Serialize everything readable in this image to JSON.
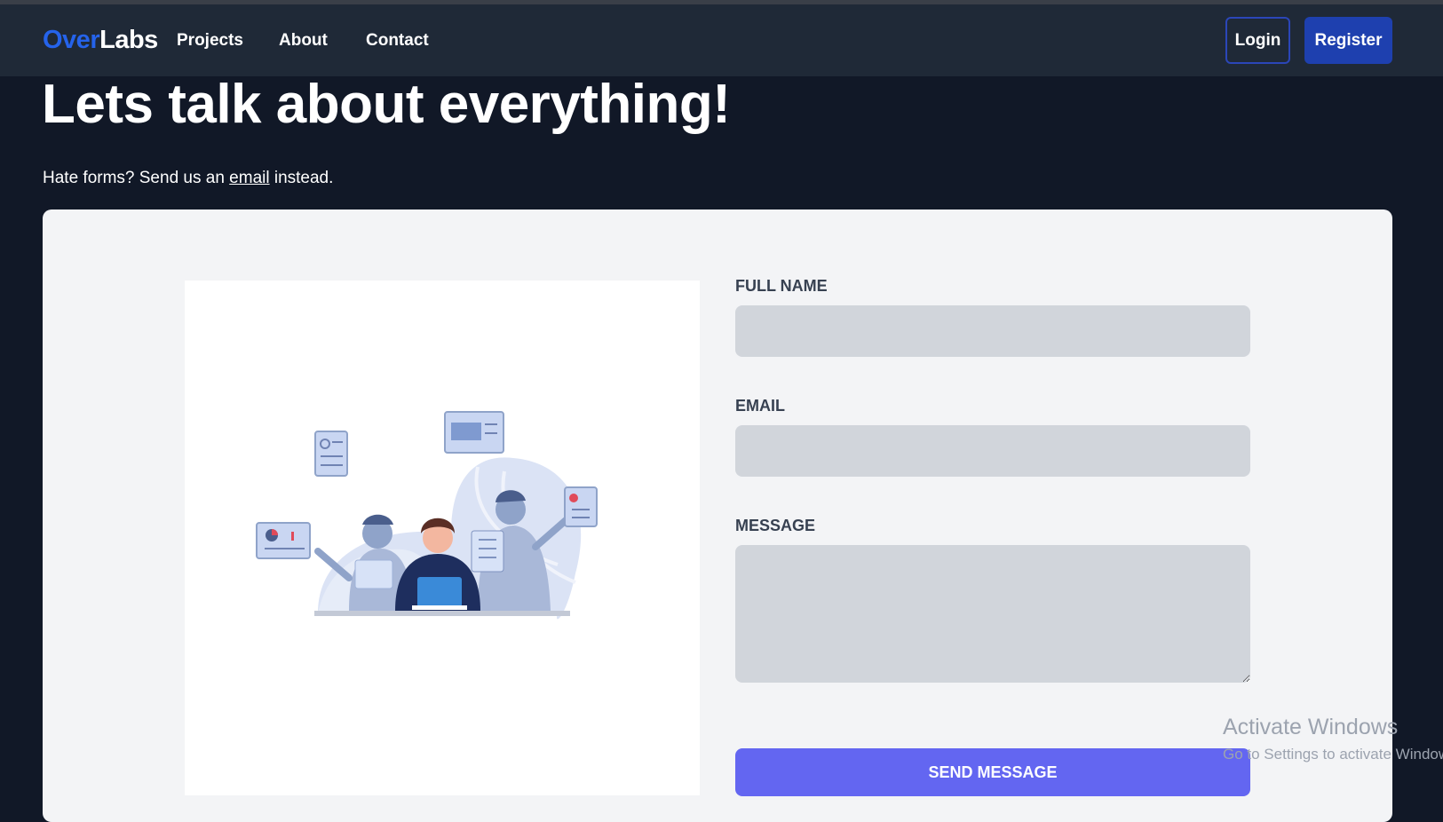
{
  "brand": {
    "part1": "Over",
    "part2": "Labs"
  },
  "nav": {
    "projects": "Projects",
    "about": "About",
    "contact": "Contact",
    "login": "Login",
    "register": "Register"
  },
  "hero": {
    "title": "Lets talk about everything!",
    "sub_before": "Hate forms? Send us an ",
    "sub_link": "email",
    "sub_after": " instead."
  },
  "form": {
    "full_name_label": "FULL NAME",
    "full_name_value": "",
    "email_label": "EMAIL",
    "email_value": "",
    "message_label": "MESSAGE",
    "message_value": "",
    "submit_label": "SEND MESSAGE"
  },
  "watermark": {
    "title": "Activate Windows",
    "subtitle": "Go to Settings to activate Windows."
  },
  "colors": {
    "brand_blue": "#2563eb",
    "register_bg": "#1e40af",
    "send_bg": "#6366f1",
    "page_bg": "#111827",
    "nav_bg": "#1f2937"
  },
  "icons": {
    "illustration": "team-at-work-illustration"
  }
}
